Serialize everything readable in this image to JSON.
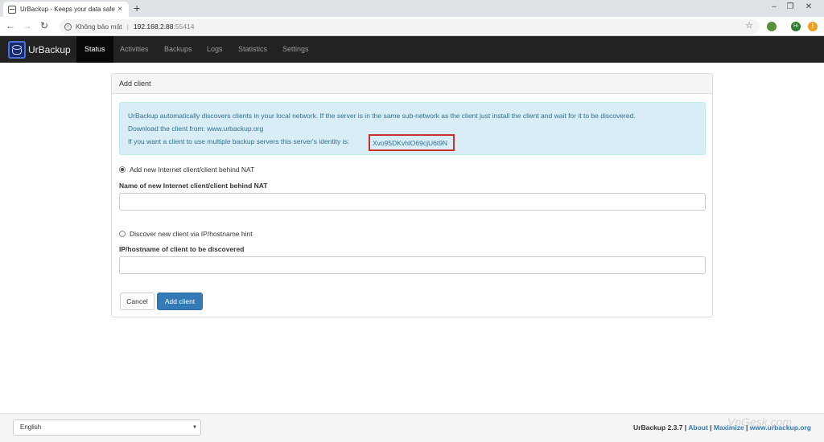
{
  "browser": {
    "tab_title": "UrBackup - Keeps your data safe",
    "tab_close": "×",
    "new_tab": "+",
    "insecure_label": "Không bảo mật",
    "url_host": "192.168.2.88",
    "url_port": ":55414",
    "ext_hi": "Hi",
    "ext_alert": "!"
  },
  "navbar": {
    "brand": "UrBackup",
    "items": [
      "Status",
      "Activities",
      "Backups",
      "Logs",
      "Statistics",
      "Settings"
    ],
    "active": "Status"
  },
  "panel": {
    "title": "Add client",
    "info_line1": "UrBackup automatically discovers clients in your local network. If the server is in the same sub-network as the client just install the client and wait for it to be discovered.",
    "info_line2_prefix": "Download the client from: ",
    "info_line2_link": "www.urbackup.org",
    "info_line3": "If you want a client to use multiple backup servers this server's identity is:",
    "identity": "Xvo95DKvhlO69cjU6t9N",
    "option_internet": "Add new Internet client/client behind NAT",
    "label_internet": "Name of new Internet client/client behind NAT",
    "internet_value": "",
    "option_discover": "Discover new client via IP/hostname hint",
    "label_discover": "IP/hostname of client to be discovered",
    "discover_value": "",
    "cancel_label": "Cancel",
    "add_label": "Add client"
  },
  "footer": {
    "language": "English",
    "version": "UrBackup 2.3.7",
    "about": "About",
    "maximize": "Maximize",
    "website": "www.urbackup.org",
    "watermark": "VnGesk.com"
  },
  "colors": {
    "navbar_bg": "#222222",
    "primary": "#337ab7",
    "info_bg": "#d9edf7",
    "highlight_border": "#c9302c"
  }
}
